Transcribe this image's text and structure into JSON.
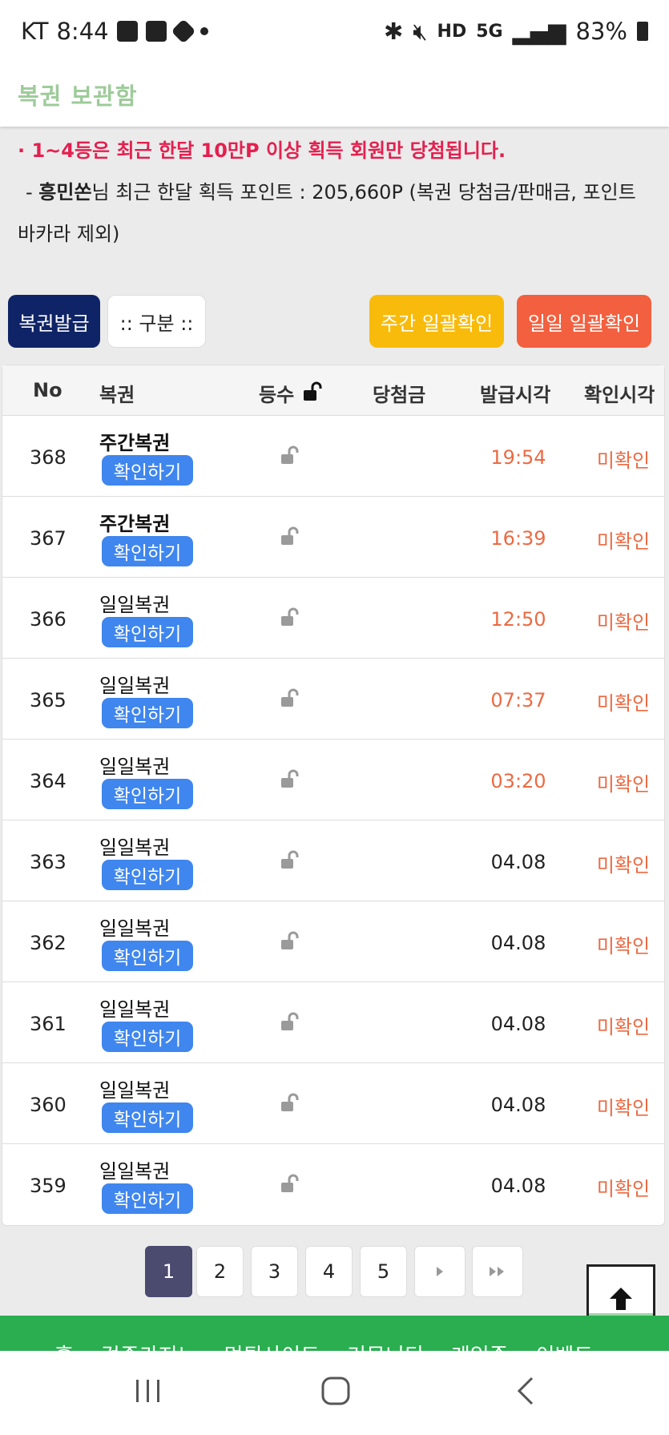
{
  "status_bar": {
    "carrier": "KT",
    "time": "8:44",
    "battery": "83%",
    "network": "5G",
    "hd": "HD"
  },
  "header": {
    "title": "복권 보관함"
  },
  "notice": {
    "line1": "· 1~4등은 최근 한달 10만P 이상 획득 회원만 당첨됩니다.",
    "line2_prefix": "- ",
    "line2_name": "흥민쏜",
    "line2_text": "님 최근 한달 획득 포인트 : 205,660P (복권 당첨금/판매금, 포인트 바카라 제외)"
  },
  "buttons": {
    "issue": "복권발급",
    "filter": ":: 구분 ::",
    "weekly_check": "주간 일괄확인",
    "daily_check": "일일 일괄확인"
  },
  "table": {
    "headers": {
      "no": "No",
      "ticket": "복권",
      "rank": "등수",
      "prize": "당첨금",
      "issued": "발급시각",
      "checked": "확인시각"
    },
    "check_label": "확인하기",
    "rows": [
      {
        "no": "368",
        "name": "주간복권",
        "time": "19:54",
        "status": "미확인"
      },
      {
        "no": "367",
        "name": "주간복권",
        "time": "16:39",
        "status": "미확인"
      },
      {
        "no": "366",
        "name": "일일복권",
        "time": "12:50",
        "status": "미확인"
      },
      {
        "no": "365",
        "name": "일일복권",
        "time": "07:37",
        "status": "미확인"
      },
      {
        "no": "364",
        "name": "일일복권",
        "time": "03:20",
        "status": "미확인"
      },
      {
        "no": "363",
        "name": "일일복권",
        "time": "04.08",
        "status": "미확인"
      },
      {
        "no": "362",
        "name": "일일복권",
        "time": "04.08",
        "status": "미확인"
      },
      {
        "no": "361",
        "name": "일일복권",
        "time": "04.08",
        "status": "미확인"
      },
      {
        "no": "360",
        "name": "일일복권",
        "time": "04.08",
        "status": "미확인"
      },
      {
        "no": "359",
        "name": "일일복권",
        "time": "04.08",
        "status": "미확인"
      }
    ]
  },
  "pagination": {
    "pages": [
      "1",
      "2",
      "3",
      "4",
      "5"
    ],
    "current": "1"
  },
  "bottom_menu": [
    "홈",
    "검증카지노",
    "먹튀사이트",
    "커뮤니티",
    "게임존",
    "이벤트"
  ],
  "colors": {
    "accent_green": "#2aae4f",
    "orange": "#ec6a42",
    "blue": "#3f86ee",
    "navy": "#0f2466",
    "yellow": "#f8bb0c",
    "red_notice": "#e3204f"
  },
  "icons": {
    "lock": "lock-open-icon",
    "to_top": "arrow-up-icon"
  }
}
